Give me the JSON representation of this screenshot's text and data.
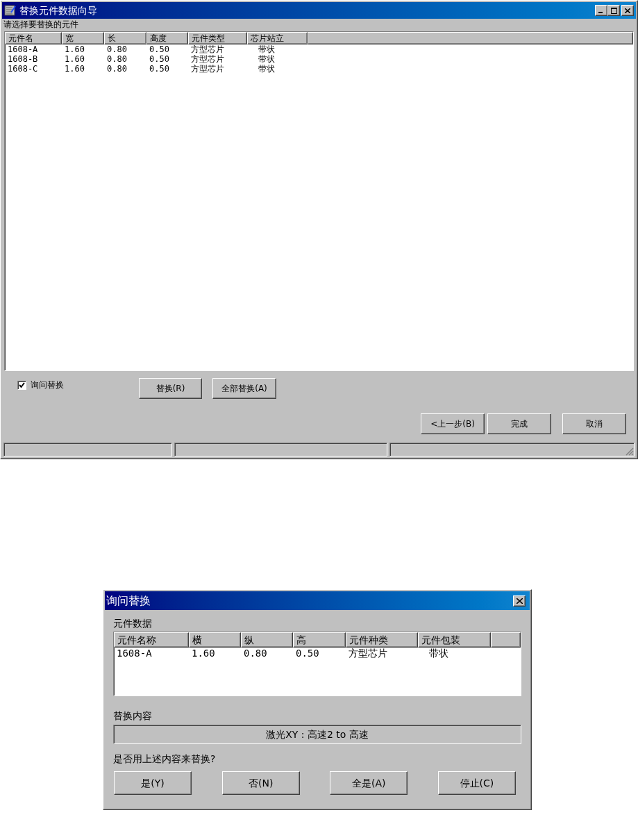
{
  "main_window": {
    "title": "替换元件数据向导",
    "prompt": "请选择要替换的元件",
    "table": {
      "columns": [
        "元件名",
        "宽",
        "长",
        "高度",
        "元件类型",
        "芯片站立"
      ],
      "rows": [
        [
          "1608-A",
          "1.60",
          "0.80",
          "0.50",
          "方型芯片",
          "带状"
        ],
        [
          "1608-B",
          "1.60",
          "0.80",
          "0.50",
          "方型芯片",
          "带状"
        ],
        [
          "1608-C",
          "1.60",
          "0.80",
          "0.50",
          "方型芯片",
          "带状"
        ]
      ]
    },
    "ask_replace": {
      "label": "询问替换",
      "checked": true
    },
    "actions": [
      {
        "label": "替换(R)"
      },
      {
        "label": "全部替换(A)"
      }
    ],
    "nav_buttons": [
      {
        "label": "<上一步(B)"
      },
      {
        "label": "完成"
      },
      {
        "label": "取消"
      }
    ]
  },
  "dialog": {
    "title": "询问替换",
    "data_label": "元件数据",
    "table": {
      "columns": [
        "元件名称",
        "横",
        "纵",
        "高",
        "元件种类",
        "元件包装"
      ],
      "rows": [
        [
          "1608-A",
          "1.60",
          "0.80",
          "0.50",
          "方型芯片",
          "带状"
        ]
      ]
    },
    "content_label": "替换内容",
    "content": "激光XY : 高速2 to 高速",
    "question": "是否用上述内容来替换?",
    "buttons": [
      {
        "label": "是(Y)"
      },
      {
        "label": "否(N)"
      },
      {
        "label": "全是(A)"
      },
      {
        "label": "停止(C)"
      }
    ]
  }
}
